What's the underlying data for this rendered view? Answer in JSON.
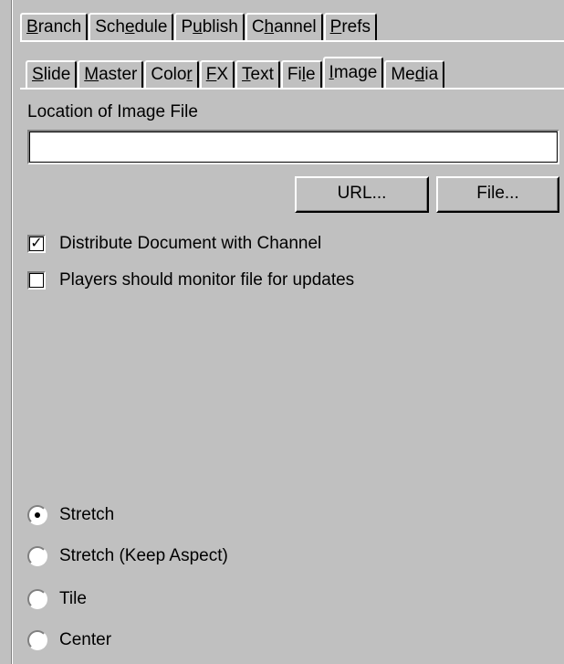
{
  "top_tabs": [
    {
      "pre": "",
      "u": "B",
      "post": "ranch"
    },
    {
      "pre": "Sch",
      "u": "e",
      "post": "dule"
    },
    {
      "pre": "P",
      "u": "u",
      "post": "blish"
    },
    {
      "pre": "C",
      "u": "h",
      "post": "annel"
    },
    {
      "pre": "",
      "u": "P",
      "post": "refs"
    }
  ],
  "sub_tabs": [
    {
      "pre": "",
      "u": "S",
      "post": "lide"
    },
    {
      "pre": "",
      "u": "M",
      "post": "aster"
    },
    {
      "pre": "Colo",
      "u": "r",
      "post": ""
    },
    {
      "pre": "",
      "u": "F",
      "post": "X"
    },
    {
      "pre": "",
      "u": "T",
      "post": "ext"
    },
    {
      "pre": "Fi",
      "u": "l",
      "post": "e"
    },
    {
      "pre": "",
      "u": "I",
      "post": "mage"
    },
    {
      "pre": "Me",
      "u": "d",
      "post": "ia"
    }
  ],
  "image_panel": {
    "location_label": "Location of Image File",
    "location_value": "",
    "url_button": "URL...",
    "file_button": "File...",
    "distribute_label": "Distribute Document with Channel",
    "distribute_checked": true,
    "monitor_label": "Players should monitor file for updates",
    "monitor_checked": false,
    "radio_options": [
      "Stretch",
      "Stretch (Keep Aspect)",
      "Tile",
      "Center"
    ],
    "selected_option": "Stretch"
  },
  "colors": {
    "face": "#c0c0c0",
    "highlight": "#ffffff",
    "shadow": "#808080"
  }
}
